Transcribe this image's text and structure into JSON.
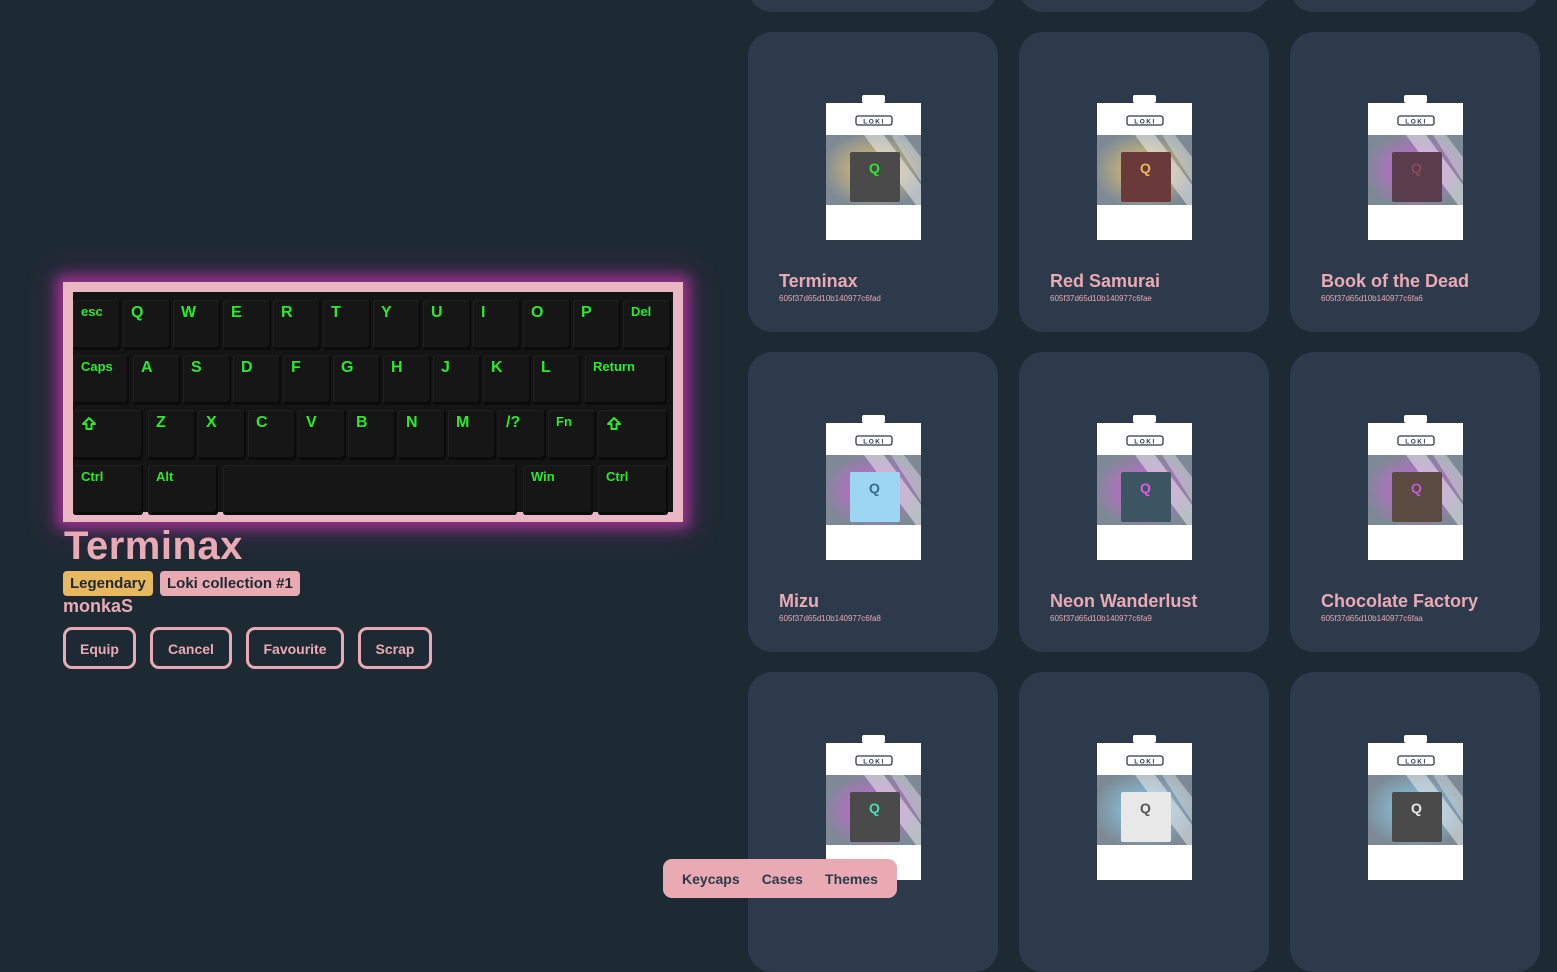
{
  "keyboard": {
    "rows": [
      [
        "esc",
        "Q",
        "W",
        "E",
        "R",
        "T",
        "Y",
        "U",
        "I",
        "O",
        "P",
        "Del"
      ],
      [
        "Caps",
        "A",
        "S",
        "D",
        "F",
        "G",
        "H",
        "J",
        "K",
        "L",
        "Return"
      ],
      [
        "shift",
        "Z",
        "X",
        "C",
        "V",
        "B",
        "N",
        "M",
        "/?",
        "Fn",
        "shift"
      ],
      [
        "Ctrl",
        "Alt",
        "",
        "Win",
        "Ctrl"
      ]
    ],
    "legend_color": "#2bea2b",
    "case_color": "#e9b7c2"
  },
  "selected": {
    "name": "Terminax",
    "rarity": "Legendary",
    "collection": "Loki collection #1",
    "owner": "monkaS"
  },
  "actions": {
    "equip": "Equip",
    "cancel": "Cancel",
    "favourite": "Favourite",
    "scrap": "Scrap"
  },
  "pack_brand": "LOKI",
  "items": [
    {
      "name": "Terminax",
      "id": "605f37d65d10b140977c6fad",
      "keycap_color": "#4a4a4a",
      "legend_color": "#2bea2b",
      "glow": "#f2c96a"
    },
    {
      "name": "Red Samurai",
      "id": "605f37d65d10b140977c6fae",
      "keycap_color": "#6a3a3a",
      "legend_color": "#e9b75e",
      "glow": "#f2c96a"
    },
    {
      "name": "Book of the Dead",
      "id": "605f37d65d10b140977c6fa6",
      "keycap_color": "#5a3d4d",
      "legend_color": "#8a4a5a",
      "glow": "#d95ce0"
    },
    {
      "name": "Mizu",
      "id": "605f37d65d10b140977c6fa8",
      "keycap_color": "#9dd6f2",
      "legend_color": "#3a6a8a",
      "glow": "#d95ce0"
    },
    {
      "name": "Neon Wanderlust",
      "id": "605f37d65d10b140977c6fa9",
      "keycap_color": "#3d5560",
      "legend_color": "#e05ce6",
      "glow": "#d95ce0"
    },
    {
      "name": "Chocolate Factory",
      "id": "605f37d65d10b140977c6faa",
      "keycap_color": "#5a4a40",
      "legend_color": "#c05cd6",
      "glow": "#d95ce0"
    },
    {
      "name": "",
      "id": "",
      "keycap_color": "#4a4a4a",
      "legend_color": "#44e0b8",
      "glow": "#d95ce0"
    },
    {
      "name": "",
      "id": "",
      "keycap_color": "#e8e8e8",
      "legend_color": "#555555",
      "glow": "#8ad4f2"
    },
    {
      "name": "",
      "id": "",
      "keycap_color": "#4a4a4a",
      "legend_color": "#e8e8e8",
      "glow": "#8ad4f2"
    }
  ],
  "nav": {
    "keycaps": "Keycaps",
    "cases": "Cases",
    "themes": "Themes"
  }
}
